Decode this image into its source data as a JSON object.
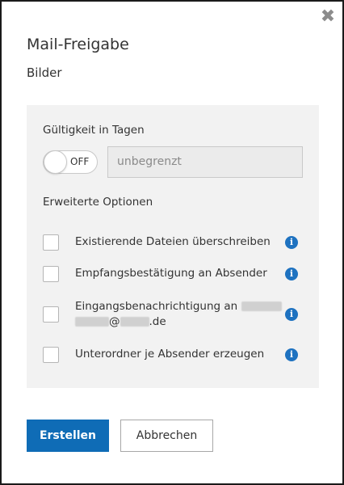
{
  "dialog": {
    "title": "Mail-Freigabe",
    "subtitle": "Bilder",
    "close_icon": "close-x-icon"
  },
  "validity": {
    "label": "Gültigkeit in Tagen",
    "toggle_state": "OFF",
    "days_placeholder": "unbegrenzt"
  },
  "advanced": {
    "label": "Erweiterte Optionen",
    "options": [
      {
        "label": "Existierende Dateien überschreiben",
        "checked": false
      },
      {
        "label": "Empfangsbestätigung an Absender",
        "checked": false
      },
      {
        "label_line1": "Eingangsbenachrichtigung an",
        "label_line2_suffix": "@",
        "label_line2_domain": ".de",
        "checked": false
      },
      {
        "label": "Unterordner je Absender erzeugen",
        "checked": false
      }
    ],
    "info_icon": "info-icon"
  },
  "buttons": {
    "create": "Erstellen",
    "cancel": "Abbrechen"
  },
  "colors": {
    "primary": "#0f6cb6",
    "info": "#1e72c0",
    "panel": "#f2f2f2"
  }
}
